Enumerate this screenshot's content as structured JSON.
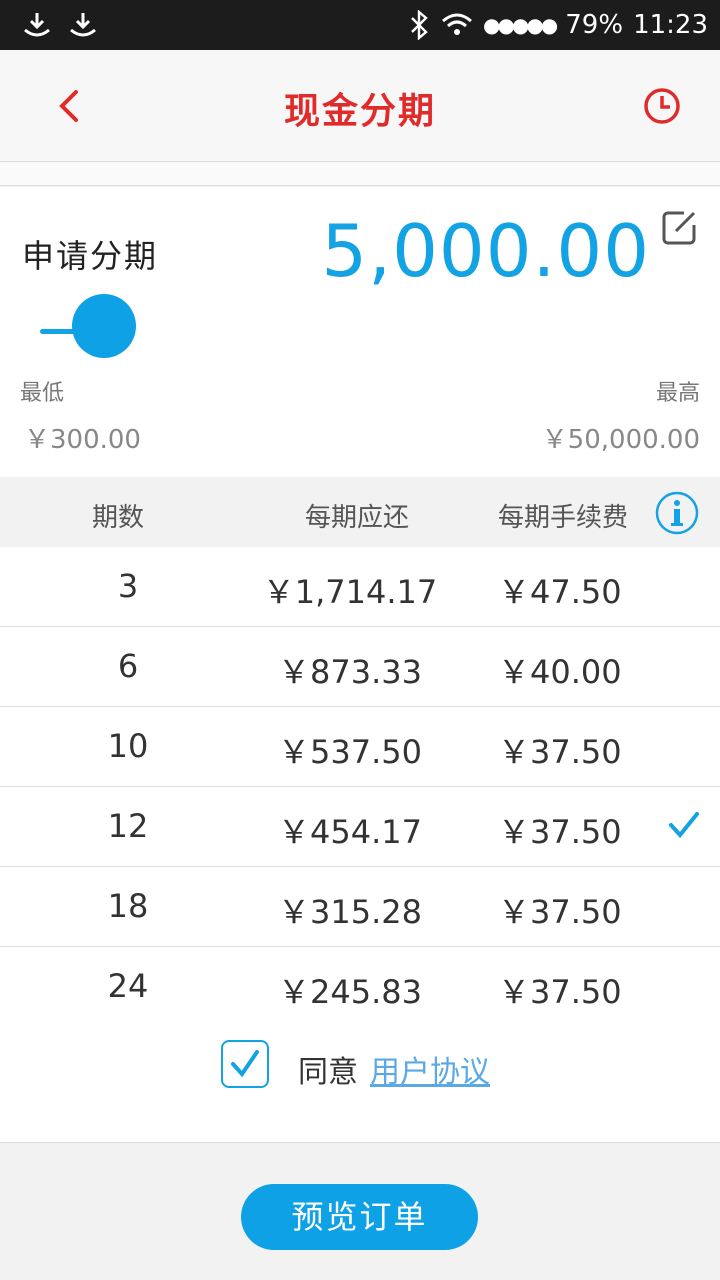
{
  "status_bar": {
    "icons": [
      "download-icon",
      "download-icon",
      "bluetooth-icon",
      "wifi-icon"
    ],
    "signal": "●●●●●",
    "battery": "79%",
    "time": "11:23"
  },
  "nav": {
    "title": "现金分期",
    "back_icon": "chevron-left-icon",
    "history_icon": "clock-icon"
  },
  "amount_card": {
    "label": "申请分期",
    "amount": "5,000.00",
    "edit_icon": "edit-icon",
    "slider_position": 0.0,
    "min_label": "最低",
    "max_label": "最高",
    "min_value": "￥300.00",
    "max_value": "￥50,000.00"
  },
  "table": {
    "headers": [
      "期数",
      "每期应还",
      "每期手续费"
    ],
    "info_icon": "info-icon",
    "rows": [
      {
        "periods": "3",
        "payment": "￥1,714.17",
        "fee": "￥47.50",
        "selected": false
      },
      {
        "periods": "6",
        "payment": "￥873.33",
        "fee": "￥40.00",
        "selected": false
      },
      {
        "periods": "10",
        "payment": "￥537.50",
        "fee": "￥37.50",
        "selected": false
      },
      {
        "periods": "12",
        "payment": "￥454.17",
        "fee": "￥37.50",
        "selected": true
      },
      {
        "periods": "18",
        "payment": "￥315.28",
        "fee": "￥37.50",
        "selected": false
      },
      {
        "periods": "24",
        "payment": "￥245.83",
        "fee": "￥37.50",
        "selected": false
      }
    ]
  },
  "agreement": {
    "checked": true,
    "text": "同意",
    "link": "用户协议"
  },
  "footer": {
    "button": "预览订单"
  },
  "colors": {
    "accent": "#0ea1e6",
    "title_red": "#e02b2b"
  }
}
